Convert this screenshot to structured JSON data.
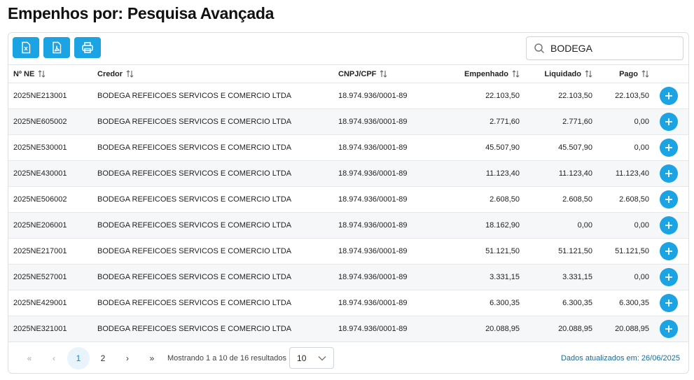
{
  "page": {
    "title": "Empenhos por: Pesquisa Avançada"
  },
  "toolbar": {
    "buttons": [
      {
        "name": "export-excel-button",
        "icon": "excel-icon"
      },
      {
        "name": "export-pdf-button",
        "icon": "pdf-icon"
      },
      {
        "name": "print-button",
        "icon": "printer-icon"
      }
    ]
  },
  "search": {
    "value": "BODEGA",
    "icon": "search-icon"
  },
  "table": {
    "headers": {
      "ne": "Nº NE",
      "credor": "Credor",
      "cnpj": "CNPJ/CPF",
      "empenhado": "Empenhado",
      "liquidado": "Liquidado",
      "pago": "Pago"
    },
    "rows": [
      {
        "ne": "2025NE213001",
        "credor": "BODEGA REFEICOES SERVICOS E COMERCIO LTDA",
        "cnpj": "18.974.936/0001-89",
        "empenhado": "22.103,50",
        "liquidado": "22.103,50",
        "pago": "22.103,50"
      },
      {
        "ne": "2025NE605002",
        "credor": "BODEGA REFEICOES SERVICOS E COMERCIO LTDA",
        "cnpj": "18.974.936/0001-89",
        "empenhado": "2.771,60",
        "liquidado": "2.771,60",
        "pago": "0,00"
      },
      {
        "ne": "2025NE530001",
        "credor": "BODEGA REFEICOES SERVICOS E COMERCIO LTDA",
        "cnpj": "18.974.936/0001-89",
        "empenhado": "45.507,90",
        "liquidado": "45.507,90",
        "pago": "0,00"
      },
      {
        "ne": "2025NE430001",
        "credor": "BODEGA REFEICOES SERVICOS E COMERCIO LTDA",
        "cnpj": "18.974.936/0001-89",
        "empenhado": "11.123,40",
        "liquidado": "11.123,40",
        "pago": "11.123,40"
      },
      {
        "ne": "2025NE506002",
        "credor": "BODEGA REFEICOES SERVICOS E COMERCIO LTDA",
        "cnpj": "18.974.936/0001-89",
        "empenhado": "2.608,50",
        "liquidado": "2.608,50",
        "pago": "2.608,50"
      },
      {
        "ne": "2025NE206001",
        "credor": "BODEGA REFEICOES SERVICOS E COMERCIO LTDA",
        "cnpj": "18.974.936/0001-89",
        "empenhado": "18.162,90",
        "liquidado": "0,00",
        "pago": "0,00"
      },
      {
        "ne": "2025NE217001",
        "credor": "BODEGA REFEICOES SERVICOS E COMERCIO LTDA",
        "cnpj": "18.974.936/0001-89",
        "empenhado": "51.121,50",
        "liquidado": "51.121,50",
        "pago": "51.121,50"
      },
      {
        "ne": "2025NE527001",
        "credor": "BODEGA REFEICOES SERVICOS E COMERCIO LTDA",
        "cnpj": "18.974.936/0001-89",
        "empenhado": "3.331,15",
        "liquidado": "3.331,15",
        "pago": "0,00"
      },
      {
        "ne": "2025NE429001",
        "credor": "BODEGA REFEICOES SERVICOS E COMERCIO LTDA",
        "cnpj": "18.974.936/0001-89",
        "empenhado": "6.300,35",
        "liquidado": "6.300,35",
        "pago": "6.300,35"
      },
      {
        "ne": "2025NE321001",
        "credor": "BODEGA REFEICOES SERVICOS E COMERCIO LTDA",
        "cnpj": "18.974.936/0001-89",
        "empenhado": "20.088,95",
        "liquidado": "20.088,95",
        "pago": "20.088,95"
      }
    ]
  },
  "pagination": {
    "first": "«",
    "prev": "‹",
    "pages": [
      "1",
      "2"
    ],
    "current": "1",
    "next": "›",
    "last": "»",
    "showing": "Mostrando 1 a 10 de 16 resultados",
    "page_size": "10"
  },
  "footer": {
    "updated": "Dados atualizados em: 26/06/2025"
  },
  "colors": {
    "accent": "#1ba3e3",
    "link": "#1a6c98"
  }
}
